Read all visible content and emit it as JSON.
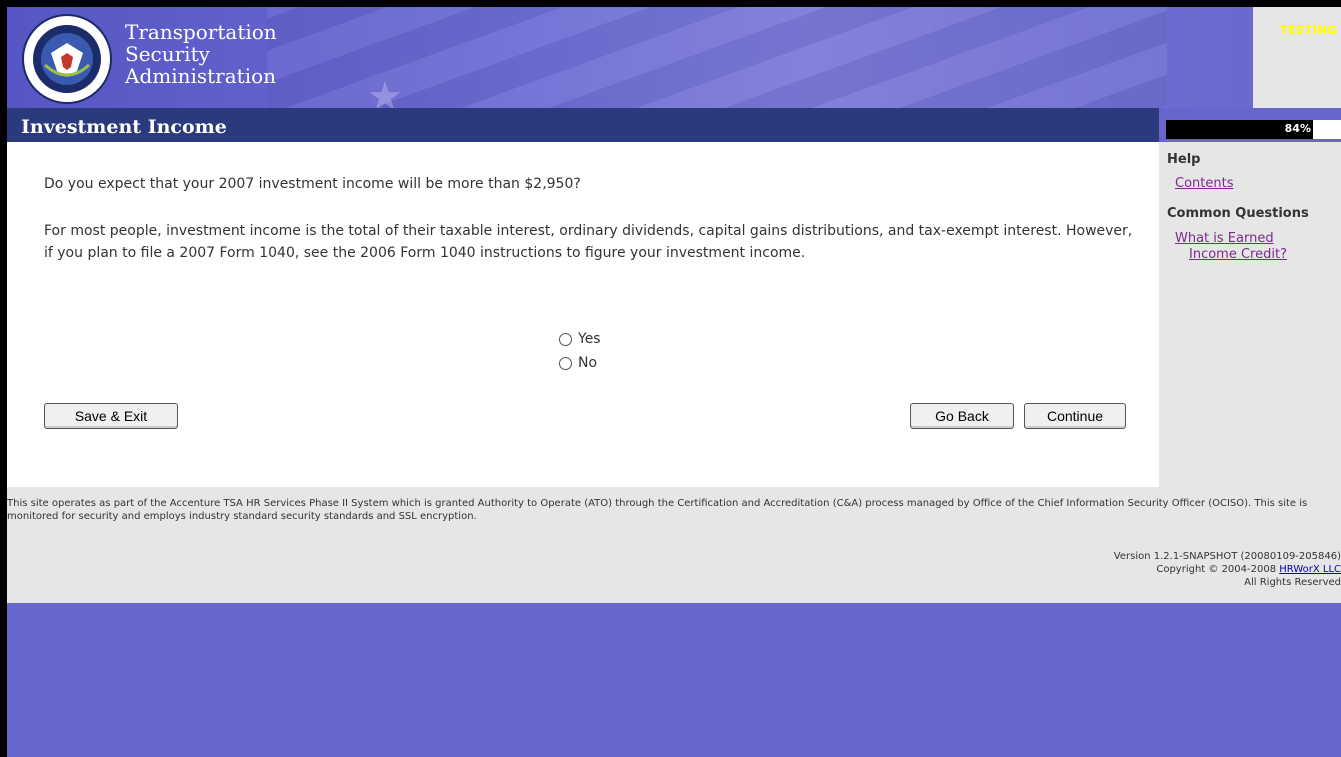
{
  "header": {
    "title_line1": "Transportation",
    "title_line2": "Security",
    "title_line3": "Administration",
    "testing_label": "TESTING",
    "seal_icon": "dhs-seal-icon"
  },
  "page": {
    "title": "Investment Income"
  },
  "progress": {
    "percent": 84,
    "label": "84%"
  },
  "main": {
    "question": "Do you expect that your 2007 investment income will be more than $2,950?",
    "explanation": "For most people, investment income is the total of their taxable interest, ordinary dividends, capital gains distributions, and tax-exempt interest. However, if you plan to file a 2007 Form 1040, see the 2006 Form 1040 instructions to figure your investment income.",
    "options": [
      "Yes",
      "No"
    ]
  },
  "buttons": {
    "save_exit": "Save & Exit",
    "go_back": "Go Back",
    "continue": "Continue"
  },
  "help": {
    "heading": "Help",
    "contents_link": "Contents",
    "common_questions_heading": "Common Questions",
    "q1_line1": "What is Earned",
    "q1_line2": "Income Credit?"
  },
  "footer": {
    "note": "This site operates as part of the Accenture TSA HR Services Phase II System which is granted Authority to Operate (ATO) through the Certification and Accreditation (C&A) process managed by Office of the Chief Information Security Officer (OCISO). This site is monitored for security and employs industry standard security standards and SSL encryption.",
    "version": "Version 1.2.1-SNAPSHOT (20080109-205846)",
    "copyright_prefix": "Copyright © 2004-2008 ",
    "company_link": "HRWorX LLC",
    "rights": "All Rights Reserved"
  },
  "colors": {
    "header_bg": "#6666cc",
    "title_bar": "#2a3a7c",
    "panel_bg": "#e6e6e6",
    "link": "#7a2a8a"
  }
}
